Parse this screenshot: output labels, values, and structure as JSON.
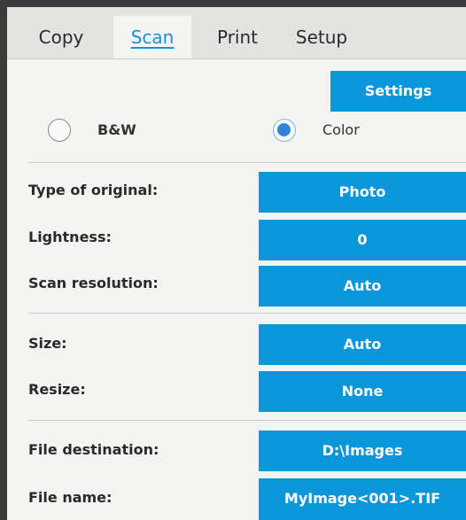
{
  "tabs": [
    {
      "label": "Copy",
      "active": false
    },
    {
      "label": "Scan",
      "active": true
    },
    {
      "label": "Print",
      "active": false
    },
    {
      "label": "Setup",
      "active": false
    }
  ],
  "settings_button": "Settings",
  "color_mode": {
    "options": [
      "B&W",
      "Color"
    ],
    "selected": "Color"
  },
  "fields": {
    "type_of_original": {
      "label": "Type of original:",
      "value": "Photo"
    },
    "lightness": {
      "label": "Lightness:",
      "value": "0"
    },
    "scan_resolution": {
      "label": "Scan resolution:",
      "value": "Auto"
    },
    "size": {
      "label": "Size:",
      "value": "Auto"
    },
    "resize": {
      "label": "Resize:",
      "value": "None"
    },
    "file_destination": {
      "label": "File destination:",
      "value": "D:\\Images"
    },
    "file_name": {
      "label": "File name:",
      "value": "MyImage<001>.TIF"
    }
  },
  "colors": {
    "accent": "#0b96d9",
    "active_tab_text": "#1a8fd6",
    "radio_selected": "#2f86d8"
  }
}
